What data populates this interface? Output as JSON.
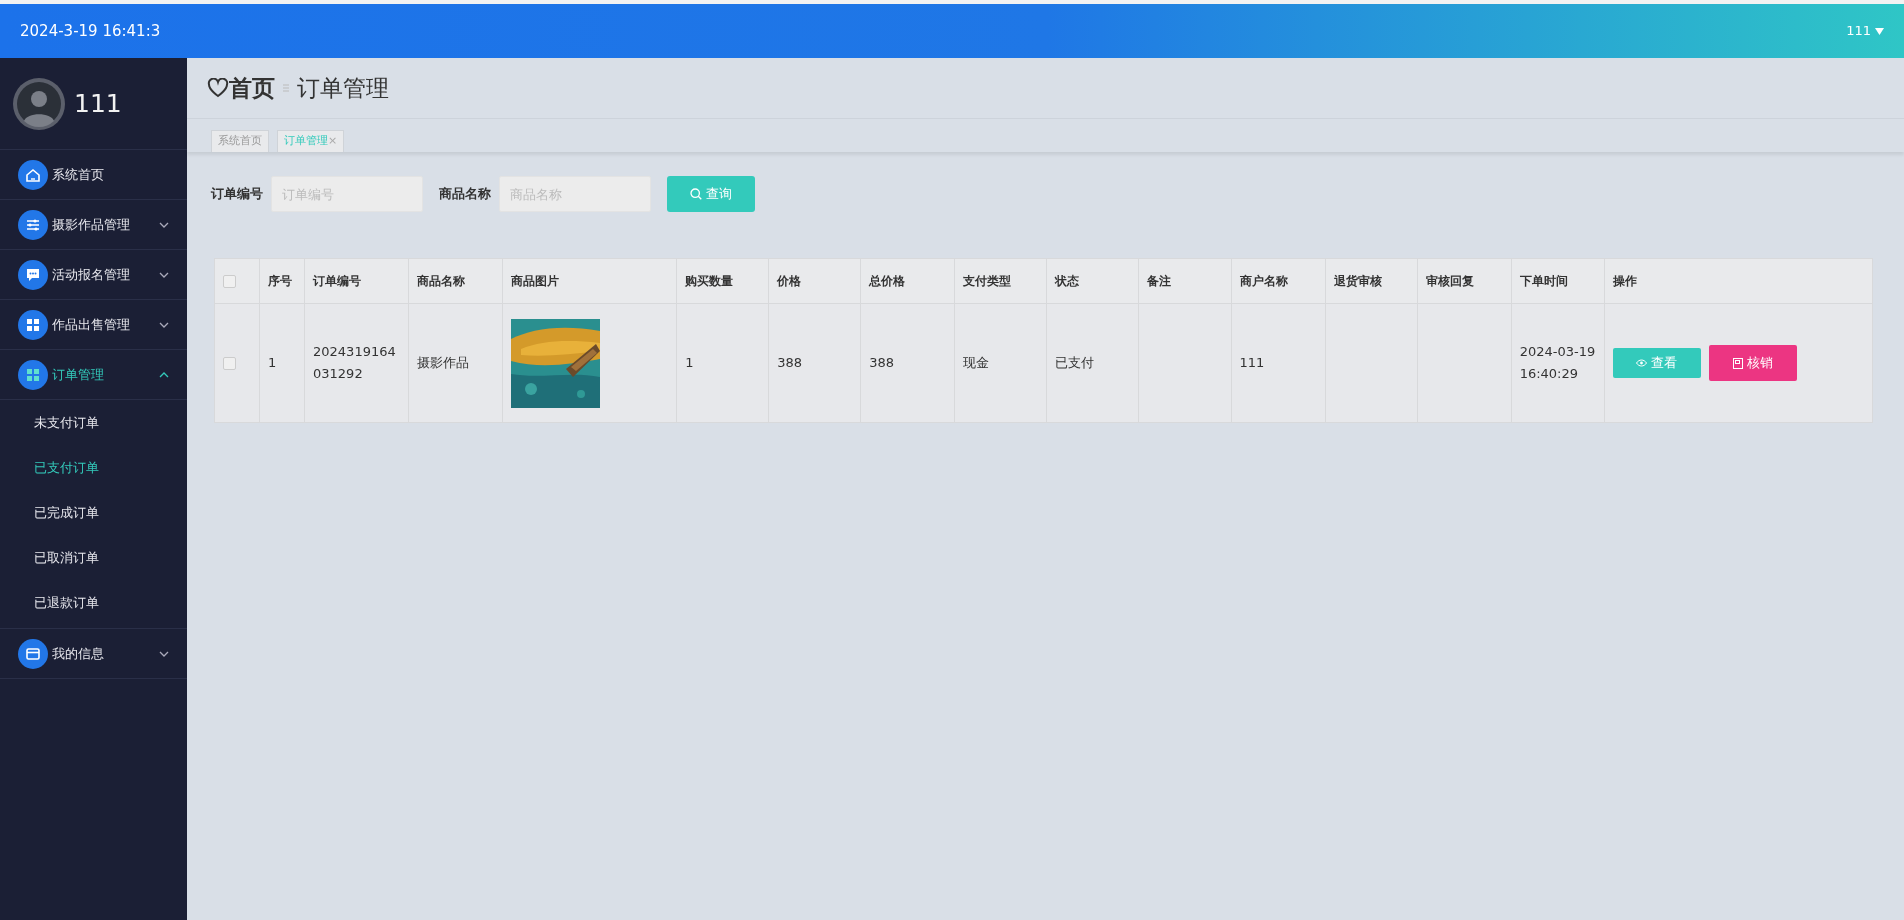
{
  "header": {
    "datetime": "2024-3-19 16:41:3",
    "user": "111"
  },
  "sidebar": {
    "user_name": "111",
    "items": [
      {
        "label": "系统首页",
        "selected": false
      },
      {
        "label": "摄影作品管理",
        "selected": false,
        "expanded": false
      },
      {
        "label": "活动报名管理",
        "selected": false,
        "expanded": false
      },
      {
        "label": "作品出售管理",
        "selected": false,
        "expanded": false
      },
      {
        "label": "订单管理",
        "selected": true,
        "expanded": true,
        "children": [
          {
            "label": "未支付订单",
            "selected": false
          },
          {
            "label": "已支付订单",
            "selected": true
          },
          {
            "label": "已完成订单",
            "selected": false
          },
          {
            "label": "已取消订单",
            "selected": false
          },
          {
            "label": "已退款订单",
            "selected": false
          }
        ]
      },
      {
        "label": "我的信息",
        "selected": false,
        "expanded": false
      }
    ]
  },
  "breadcrumb": {
    "home": "首页",
    "current": "订单管理"
  },
  "tabs": [
    {
      "label": "系统首页",
      "selected": false
    },
    {
      "label": "订单管理",
      "selected": true,
      "close": "×"
    }
  ],
  "search": {
    "fields": [
      {
        "label": "订单编号",
        "placeholder": "订单编号"
      },
      {
        "label": "商品名称",
        "placeholder": "商品名称"
      }
    ],
    "button": "查询"
  },
  "table": {
    "select_all": false,
    "columns": [
      "序号",
      "订单编号",
      "商品名称",
      "商品图片",
      "购买数量",
      "价格",
      "总价格",
      "支付类型",
      "状态",
      "备注",
      "商户名称",
      "退货审核",
      "审核回复",
      "下单时间",
      "操作"
    ],
    "rows": [
      {
        "checked": false,
        "cells": [
          {
            "kind": "text",
            "text": "1"
          },
          {
            "kind": "text",
            "text": "2024319164031292"
          },
          {
            "kind": "text",
            "text": "摄影作品"
          },
          {
            "kind": "picture"
          },
          {
            "kind": "text",
            "text": "1"
          },
          {
            "kind": "text",
            "text": "388"
          },
          {
            "kind": "text",
            "text": "388"
          },
          {
            "kind": "text",
            "text": "现金"
          },
          {
            "kind": "text",
            "text": "已支付"
          },
          {
            "kind": "blank"
          },
          {
            "kind": "text",
            "text": "111"
          },
          {
            "kind": "blank"
          },
          {
            "kind": "blank"
          },
          {
            "kind": "text",
            "text": "2024-03-19 16:40:29"
          },
          {
            "kind": "actions",
            "buttons": [
              {
                "kind": "view",
                "label": "查看"
              },
              {
                "kind": "verify",
                "label": "核销"
              }
            ]
          }
        ]
      }
    ]
  }
}
